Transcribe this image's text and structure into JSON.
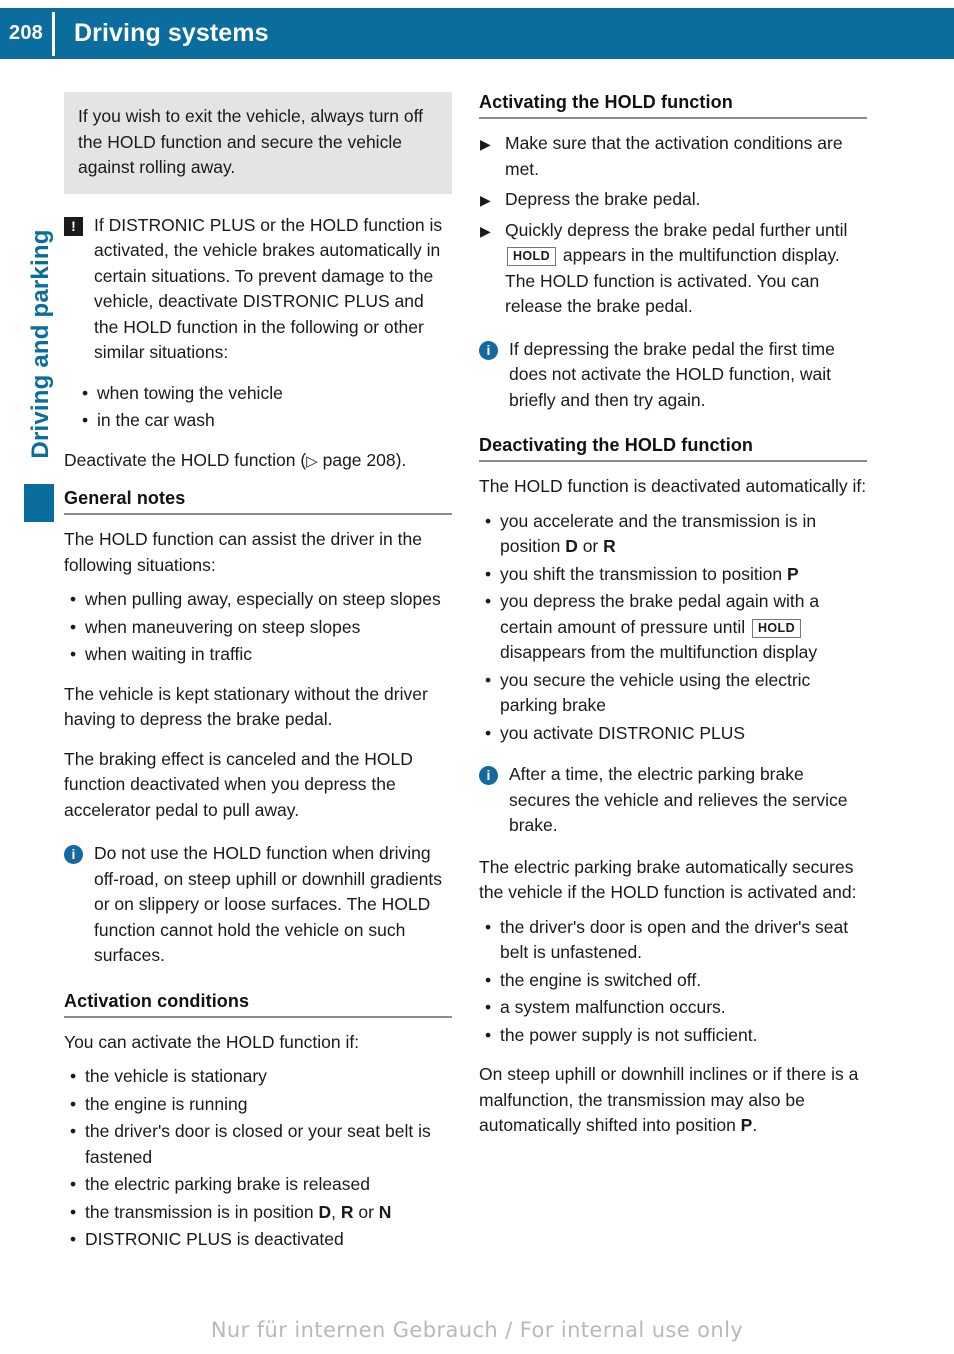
{
  "header": {
    "page_number": "208",
    "title": "Driving systems"
  },
  "side_tab": {
    "label": "Driving and parking"
  },
  "left_column": {
    "warning_box": {
      "text": "If you wish to exit the vehicle, always turn off the HOLD function and secure the vehicle against rolling away."
    },
    "caution_note": {
      "icon": "warning-exclamation-icon",
      "text": "If DISTRONIC PLUS or the HOLD function is activated, the vehicle brakes automatically in certain situations. To prevent damage to the vehicle, deactivate DISTRONIC PLUS and the HOLD function in the following or other similar situations:",
      "bullets": [
        "when towing the vehicle",
        "in the car wash"
      ],
      "closing_prefix": "Deactivate the HOLD function (",
      "closing_arrow": "▷",
      "closing_suffix": " page 208)."
    },
    "general_notes": {
      "heading": "General notes",
      "intro": "The HOLD function can assist the driver in the following situations:",
      "bullets": [
        "when pulling away, especially on steep slopes",
        "when maneuvering on steep slopes",
        "when waiting in traffic"
      ],
      "para_1": "The vehicle is kept stationary without the driver having to depress the brake pedal.",
      "para_2": "The braking effect is canceled and the HOLD function deactivated when you depress the accelerator pedal to pull away.",
      "info_note": {
        "icon": "info-circle-icon",
        "text": "Do not use the HOLD function when driving off-road, on steep uphill or downhill gradients or on slippery or loose surfaces. The HOLD function cannot hold the vehicle on such surfaces."
      }
    },
    "activation_conditions": {
      "heading": "Activation conditions",
      "intro": "You can activate the HOLD function if:",
      "bullets": [
        {
          "text_before": "the vehicle is stationary",
          "bold_parts": []
        },
        {
          "text_before": "the engine is running",
          "bold_parts": []
        },
        {
          "text_before": "the driver's door is closed or your seat belt is fastened",
          "bold_parts": []
        },
        {
          "text_before": "the electric parking brake is released",
          "bold_parts": []
        },
        {
          "text_before": "the transmission is in position ",
          "gear_1": "D",
          "sep_1": ", ",
          "gear_2": "R",
          "sep_2": " or ",
          "gear_3": "N"
        },
        {
          "text_before": "DISTRONIC PLUS is deactivated",
          "bold_parts": []
        }
      ]
    }
  },
  "right_column": {
    "activating": {
      "heading": "Activating the HOLD function",
      "steps": [
        {
          "text": "Make sure that the activation conditions are met."
        },
        {
          "text": "Depress the brake pedal."
        },
        {
          "text_before": "Quickly depress the brake pedal further until ",
          "display_label": "HOLD",
          "text_after": " appears in the multifunction display.",
          "sub_text": "The HOLD function is activated. You can release the brake pedal."
        }
      ],
      "info_note": {
        "icon": "info-circle-icon",
        "text": "If depressing the brake pedal the first time does not activate the HOLD function, wait briefly and then try again."
      }
    },
    "deactivating": {
      "heading": "Deactivating the HOLD function",
      "intro": "The HOLD function is deactivated automatically if:",
      "bullets": [
        {
          "text_before": "you accelerate and the transmission is in position ",
          "gear_1": "D",
          "sep_1": " or ",
          "gear_2": "R"
        },
        {
          "text_before": "you shift the transmission to position ",
          "gear_1": "P"
        },
        {
          "text_before": "you depress the brake pedal again with a certain amount of pressure until ",
          "display_label": "HOLD",
          "text_after": " disappears from the multifunction display"
        },
        {
          "text_before": "you secure the vehicle using the electric parking brake"
        },
        {
          "text_before": "you activate DISTRONIC PLUS"
        }
      ],
      "info_note": {
        "icon": "info-circle-icon",
        "text": "After a time, the electric parking brake secures the vehicle and relieves the service brake."
      },
      "para_epb": "The electric parking brake automatically secures the vehicle if the HOLD function is activated and:",
      "epb_bullets": [
        "the driver's door is open and the driver's seat belt is unfastened.",
        "the engine is switched off.",
        "a system malfunction occurs.",
        "the power supply is not sufficient."
      ],
      "closing_before": "On steep uphill or downhill inclines or if there is a malfunction, the transmission may also be automatically shifted into position ",
      "closing_gear": "P",
      "closing_after": "."
    }
  },
  "footer": {
    "watermark": "Nur für internen Gebrauch / For internal use only"
  },
  "colors": {
    "header_blue": "#0a6d9e",
    "info_icon_blue": "#15699e",
    "gray_box": "#e4e4e4",
    "rule_gray": "#8c8c8c",
    "watermark_gray": "#b9b9b9"
  }
}
